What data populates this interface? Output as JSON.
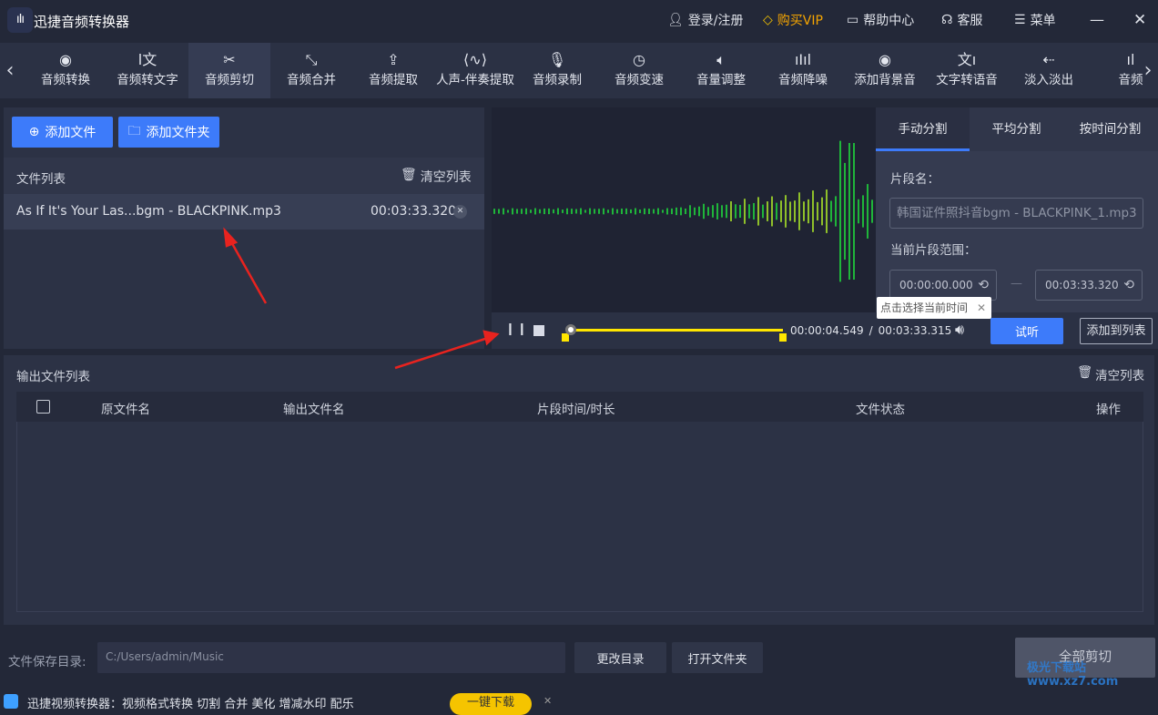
{
  "app": {
    "title": "迅捷音频转换器",
    "logo": "ıIı"
  },
  "titlebar": {
    "login": "登录/注册",
    "vip": "购买VIP",
    "help": "帮助中心",
    "service": "客服",
    "menu": "菜单",
    "vip_color": "#f5c400"
  },
  "toolbar": {
    "items": [
      "音频转换",
      "音频转文字",
      "音频剪切",
      "音频合并",
      "音频提取",
      "人声-伴奏提取",
      "音频录制",
      "音频变速",
      "音量调整",
      "音频降噪",
      "添加背景音",
      "文字转语音",
      "淡入淡出",
      "音频"
    ],
    "active": "音频剪切"
  },
  "left": {
    "add_file": "添加文件",
    "add_folder": "添加文件夹",
    "list_title": "文件列表",
    "clear": "清空列表",
    "files": [
      {
        "name": "As If It's Your Las...bgm - BLACKPINK.mp3",
        "duration": "00:03:33.320"
      }
    ]
  },
  "player": {
    "current": "00:00:04.549",
    "sep": "/",
    "total": "00:03:33.315",
    "preview": "试听",
    "add_to_list": "添加到列表",
    "progress_fraction": 0.02
  },
  "split": {
    "tabs": [
      "手动分割",
      "平均分割",
      "按时间分割"
    ],
    "active": "手动分割",
    "segment_name_label": "片段名：",
    "segment_name": "韩国证件照抖音bgm - BLACKPINK_1.mp3",
    "range_label": "当前片段范围：",
    "start": "00:00:00.000",
    "dash": "—",
    "end": "00:03:33.320",
    "tooltip": "点击选择当前时间"
  },
  "output": {
    "title": "输出文件列表",
    "clear": "清空列表",
    "columns": [
      "原文件名",
      "输出文件名",
      "片段时间/时长",
      "文件状态",
      "操作"
    ]
  },
  "footer": {
    "save_dir_label": "文件保存目录:",
    "save_dir": "C:/Users/admin/Music",
    "change_dir": "更改目录",
    "open_folder": "打开文件夹",
    "cut_all": "全部剪切",
    "ad_text": "迅捷视频转换器：视频格式转换  切割  合并  美化  增减水印  配乐",
    "ad_button": "一键下载",
    "watermark": "极光下载站 www.xz7.com"
  }
}
